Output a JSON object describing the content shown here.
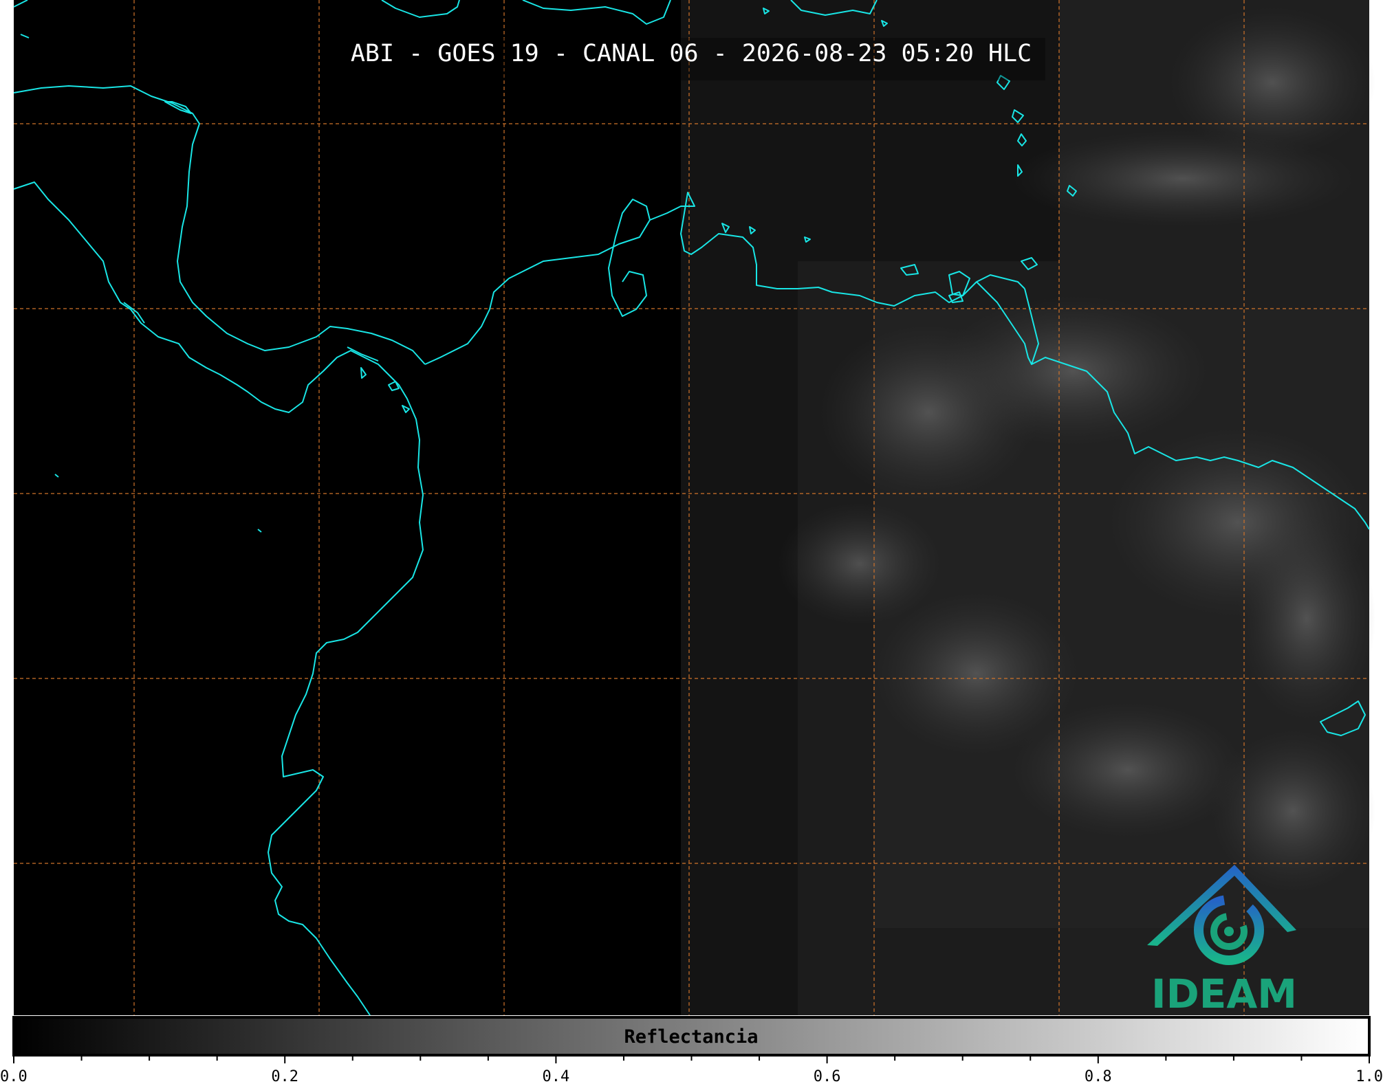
{
  "title": "ABI - GOES 19 - CANAL 06 - 2026-08-23 05:20 HLC",
  "colorbar": {
    "label": "Reflectancia",
    "ticks": [
      "0.0",
      "0.2",
      "0.4",
      "0.6",
      "0.8",
      "1.0"
    ],
    "range": [
      0.0,
      1.0
    ],
    "colormap": "grayscale"
  },
  "logo": {
    "text": "IDEAM"
  },
  "colors": {
    "coastline": "#19e6e6",
    "gridlines": "#d0732a",
    "background": "#000000",
    "logo_green": "#1aa37a",
    "logo_blue": "#1f78b4"
  }
}
